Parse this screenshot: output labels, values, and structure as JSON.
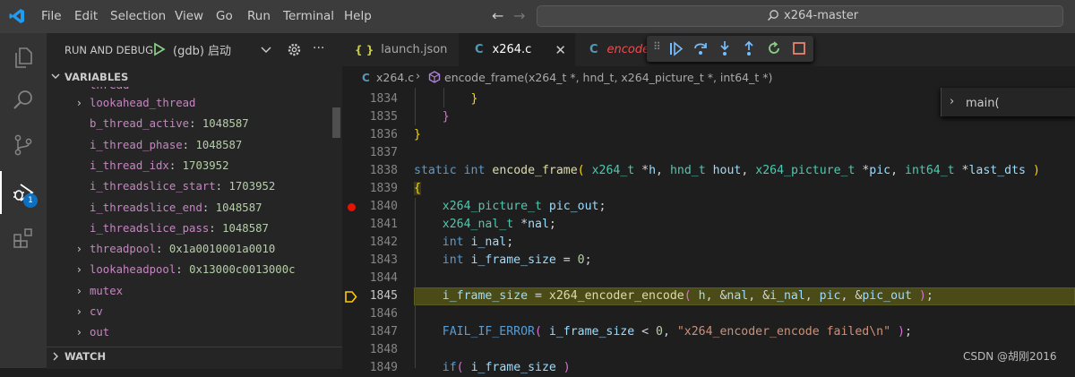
{
  "menu": [
    "File",
    "Edit",
    "Selection",
    "View",
    "Go",
    "Run",
    "Terminal",
    "Help"
  ],
  "search": {
    "label": "x264-master"
  },
  "sidebar": {
    "title": "RUN AND DEBUG",
    "config": "(gdb) 启动",
    "variables_header": "VARIABLES",
    "watch_header": "WATCH",
    "partial_top": "thread",
    "variables": [
      {
        "name": "lookahead_thread",
        "value": "",
        "expandable": true
      },
      {
        "name": "b_thread_active",
        "value": "1048587",
        "expandable": false
      },
      {
        "name": "i_thread_phase",
        "value": "1048587",
        "expandable": false
      },
      {
        "name": "i_thread_idx",
        "value": "1703952",
        "expandable": false
      },
      {
        "name": "i_threadslice_start",
        "value": "1703952",
        "expandable": false
      },
      {
        "name": "i_threadslice_end",
        "value": "1048587",
        "expandable": false
      },
      {
        "name": "i_threadslice_pass",
        "value": "1048587",
        "expandable": false
      },
      {
        "name": "threadpool",
        "value": "0x1a0010001a0010",
        "expandable": true
      },
      {
        "name": "lookaheadpool",
        "value": "0x13000c0013000c",
        "expandable": true
      },
      {
        "name": "mutex",
        "value": "",
        "expandable": true
      },
      {
        "name": "cv",
        "value": "",
        "expandable": true
      },
      {
        "name": "out",
        "value": "",
        "expandable": true
      }
    ],
    "badge": "1"
  },
  "tabs": [
    {
      "label": "launch.json",
      "icon": "{ }"
    },
    {
      "label": "x264.c",
      "icon": "C"
    },
    {
      "label": "encoder",
      "icon": "C"
    }
  ],
  "breadcrumb": {
    "file": "x264.c",
    "symbol": "encode_frame(x264_t *, hnd_t, x264_picture_t *, int64_t *)"
  },
  "peek": {
    "text": "main("
  },
  "editor": {
    "line_numbers": [
      "1834",
      "1835",
      "1836",
      "1837",
      "1838",
      "1839",
      "1840",
      "1841",
      "1842",
      "1843",
      "1844",
      "1845",
      "1846",
      "1847",
      "1848",
      "1849"
    ],
    "current_line": "1845",
    "breakpoint_line": "1840"
  },
  "watermark": "CSDN @胡刚2016",
  "colors": {
    "accent": "#0e70c0",
    "breakpoint": "#e51400",
    "current_line": "#4b4b18"
  }
}
